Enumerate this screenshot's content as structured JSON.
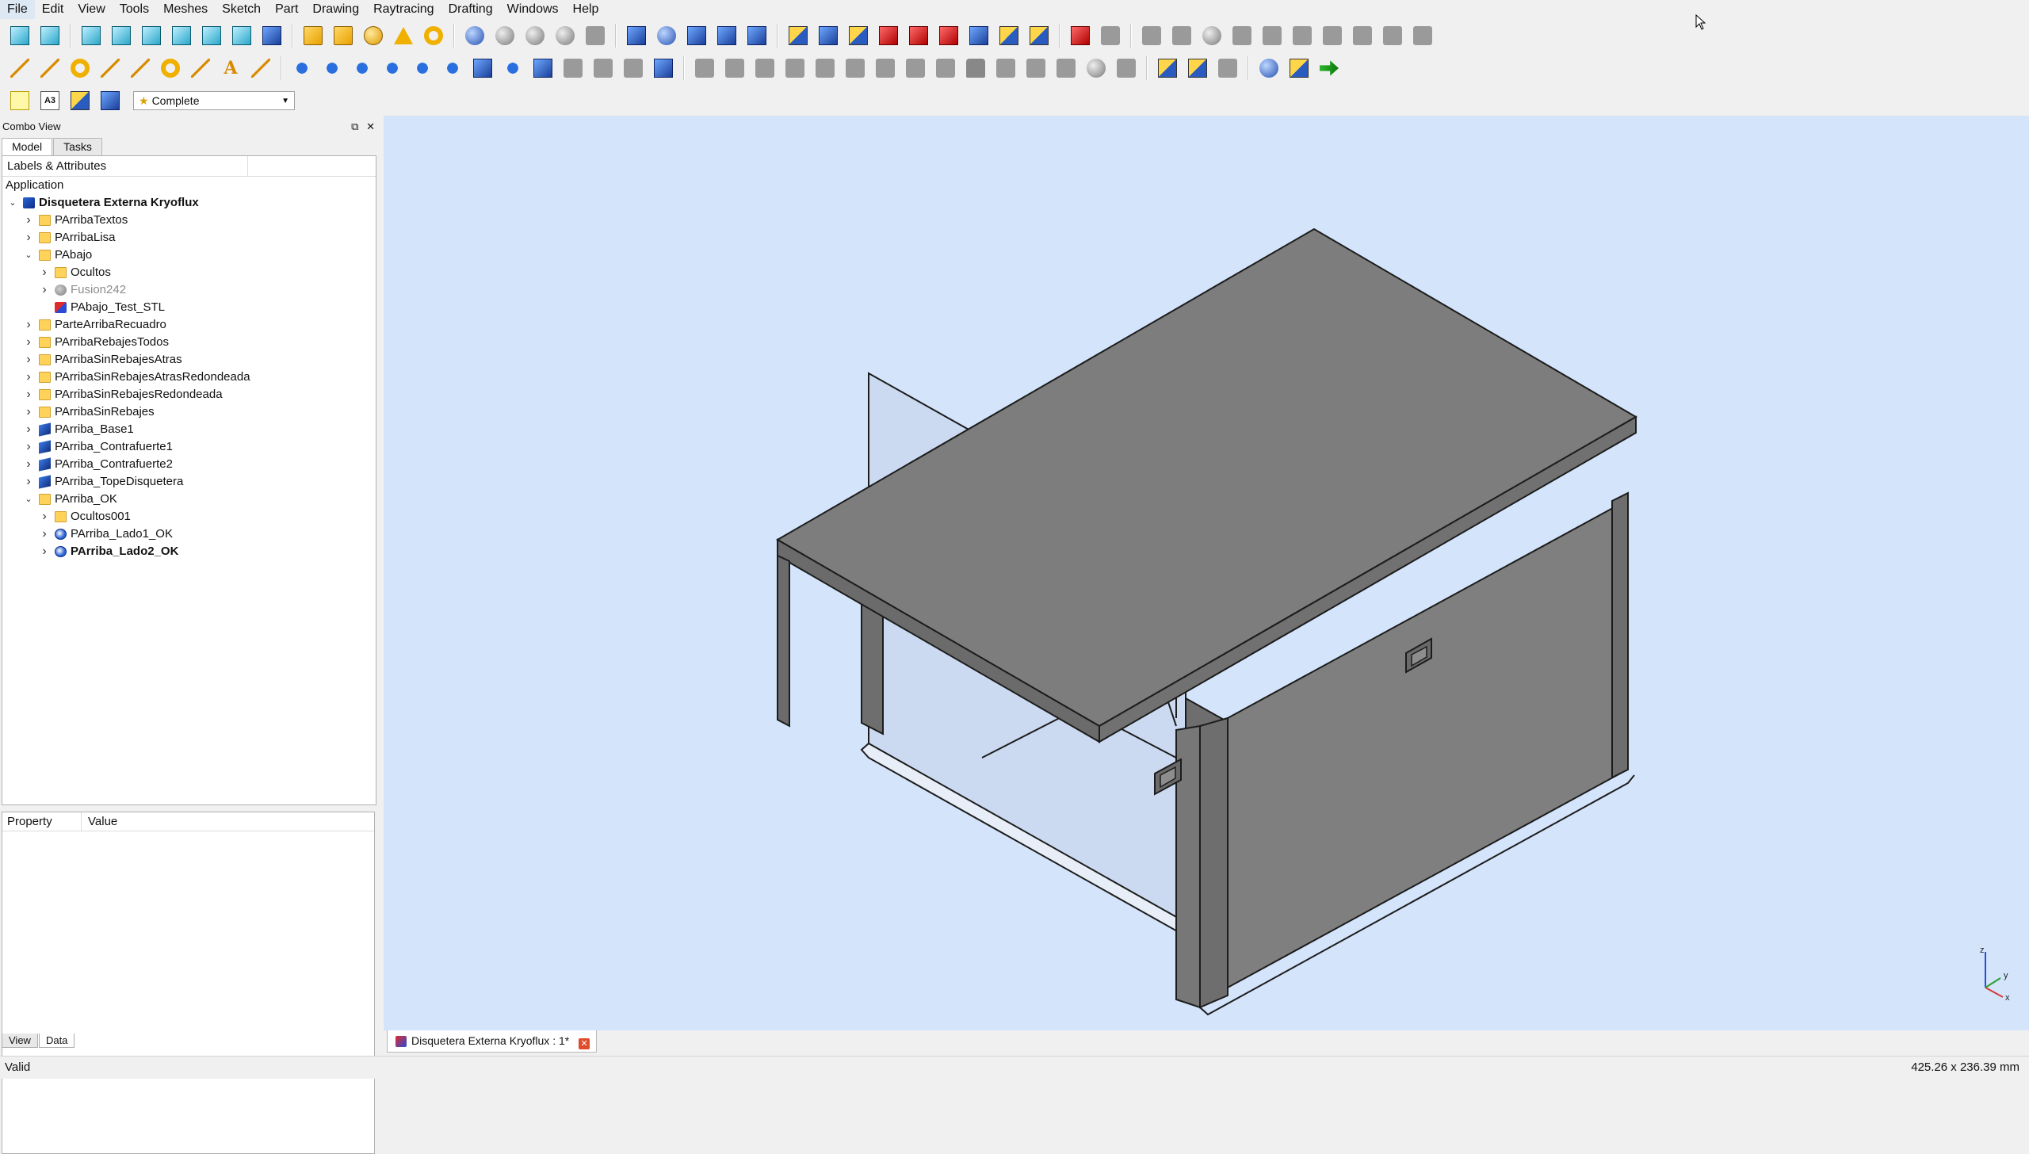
{
  "menu": [
    "File",
    "Edit",
    "View",
    "Tools",
    "Meshes",
    "Sketch",
    "Part",
    "Drawing",
    "Raytracing",
    "Drafting",
    "Windows",
    "Help"
  ],
  "workbench_selector": {
    "value": "Complete"
  },
  "toolbar3_a3": "A3",
  "combo": {
    "title": "Combo View",
    "float_glyph": "⧉",
    "close_glyph": "✕",
    "tabs": [
      "Model",
      "Tasks"
    ],
    "tree_header": "Labels & Attributes",
    "section": "Application",
    "items": [
      {
        "label": "Disquetera Externa Kryoflux",
        "icon": "doc",
        "level": 0,
        "expander": "open",
        "bold": true
      },
      {
        "label": "PArribaTextos",
        "icon": "folder",
        "level": 1,
        "expander": "closed"
      },
      {
        "label": "PArribaLisa",
        "icon": "folder",
        "level": 1,
        "expander": "closed"
      },
      {
        "label": "PAbajo",
        "icon": "folder",
        "level": 1,
        "expander": "open"
      },
      {
        "label": "Ocultos",
        "icon": "folder",
        "level": 2,
        "expander": "closed"
      },
      {
        "label": "Fusion242",
        "icon": "fusion",
        "level": 2,
        "expander": "closed",
        "gray": true
      },
      {
        "label": "PAbajo_Test_STL",
        "icon": "stl",
        "level": 2,
        "expander": "none"
      },
      {
        "label": "ParteArribaRecuadro",
        "icon": "folder",
        "level": 1,
        "expander": "closed"
      },
      {
        "label": "PArribaRebajesTodos",
        "icon": "folder",
        "level": 1,
        "expander": "closed"
      },
      {
        "label": "PArribaSinRebajesAtras",
        "icon": "folder",
        "level": 1,
        "expander": "closed"
      },
      {
        "label": "PArribaSinRebajesAtrasRedondeada",
        "icon": "folder",
        "level": 1,
        "expander": "closed"
      },
      {
        "label": "PArribaSinRebajesRedondeada",
        "icon": "folder",
        "level": 1,
        "expander": "closed"
      },
      {
        "label": "PArribaSinRebajes",
        "icon": "folder",
        "level": 1,
        "expander": "closed"
      },
      {
        "label": "PArriba_Base1",
        "icon": "body",
        "level": 1,
        "expander": "closed"
      },
      {
        "label": "PArriba_Contrafuerte1",
        "icon": "body",
        "level": 1,
        "expander": "closed"
      },
      {
        "label": "PArriba_Contrafuerte2",
        "icon": "body",
        "level": 1,
        "expander": "closed"
      },
      {
        "label": "PArriba_TopeDisquetera",
        "icon": "body",
        "level": 1,
        "expander": "closed"
      },
      {
        "label": "PArriba_OK",
        "icon": "folder",
        "level": 1,
        "expander": "open"
      },
      {
        "label": "Ocultos001",
        "icon": "folder",
        "level": 2,
        "expander": "closed"
      },
      {
        "label": "PArriba_Lado1_OK",
        "icon": "sphere",
        "level": 2,
        "expander": "closed"
      },
      {
        "label": "PArriba_Lado2_OK",
        "icon": "sphere",
        "level": 2,
        "expander": "closed",
        "bold": true
      }
    ],
    "property_header": "Property",
    "value_header": "Value",
    "bottom_tabs": [
      "View",
      "Data"
    ]
  },
  "document_tab": {
    "label": "Disquetera Externa Kryoflux : 1*",
    "close_glyph": "✕"
  },
  "axis_labels": {
    "x": "x",
    "y": "y",
    "z": "z"
  },
  "status": {
    "left": "Valid",
    "right": "425.26 x 236.39 mm"
  },
  "colors": {
    "viewport_bg": "#d3e4fb",
    "model_gray": "#7d7d7d",
    "accent": "#2b63d6"
  }
}
